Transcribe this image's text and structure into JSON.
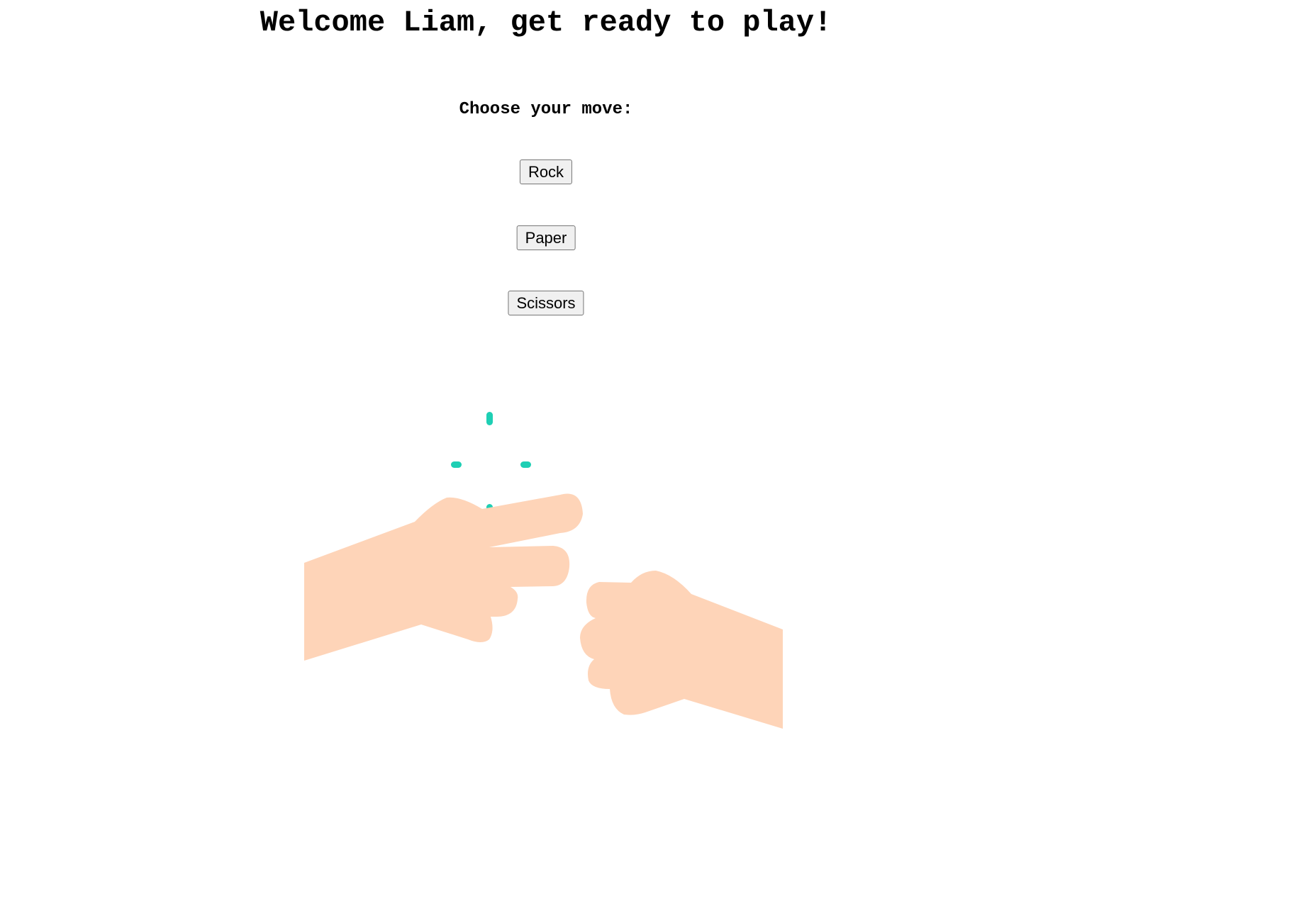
{
  "header": {
    "title": "Welcome Liam, get ready to play!"
  },
  "game": {
    "prompt": "Choose your move:",
    "moves": [
      {
        "label": "Rock"
      },
      {
        "label": "Paper"
      },
      {
        "label": "Scissors"
      }
    ]
  },
  "illustration": {
    "description_icon": "hands-icon",
    "skin_color": "#fed4b8",
    "accent_color": "#1ecfb4"
  }
}
